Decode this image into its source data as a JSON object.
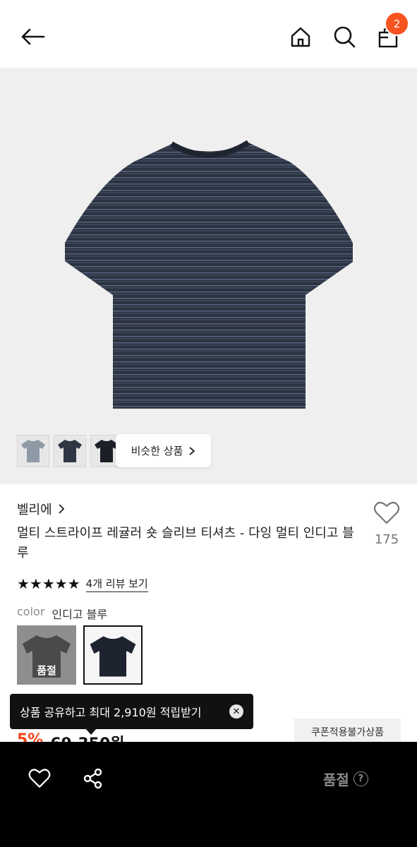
{
  "header": {
    "back_icon": "arrow-left-icon",
    "home_icon": "home-icon",
    "search_icon": "search-icon",
    "cart_icon": "shopping-bag-icon",
    "cart_badge": "2",
    "badge_color": "#f7531f"
  },
  "gallery": {
    "product_image": "striped-t-shirt",
    "thumbnails": [
      "light-grey-t-shirt",
      "navy-t-shirt",
      "black-t-shirt"
    ],
    "similar_label": "비슷한 상품",
    "similar_icon": "chevron-right-icon"
  },
  "product": {
    "brand": "벨리에",
    "brand_icon": "chevron-right-icon",
    "title": "멀티 스트라이프 레귤러 숏 슬리브 티셔츠 - 다잉 멀티 인디고 블루",
    "like_count": "175",
    "rating_stars": "★★★★★",
    "rating_value": 5,
    "review_link": "4개 리뷰 보기",
    "color_label": "color",
    "color_value": "인디고 블루",
    "swatches": [
      {
        "name": "grey",
        "tag": "품절"
      },
      {
        "name": "navy",
        "tag": ""
      }
    ]
  },
  "tooltip": {
    "text": "상품 공유하고 최대 2,910원 적립받기",
    "close_icon": "close-icon"
  },
  "coupon_badge": "쿠폰적용불가상품",
  "price": {
    "discount": "5%",
    "amount": "69,350원",
    "discount_color": "#f3461b"
  },
  "bottom_bar": {
    "wishlist_icon": "heart-icon",
    "share_icon": "share-icon",
    "status_label": "품절",
    "help_icon": "question-icon",
    "help_glyph": "?"
  }
}
